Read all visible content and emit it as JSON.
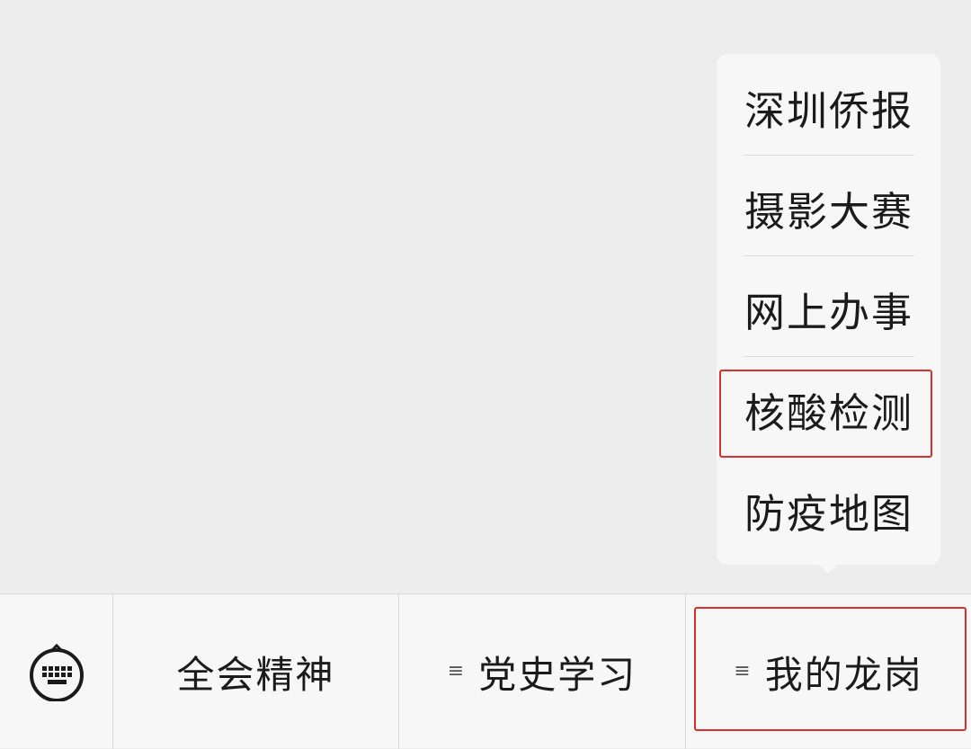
{
  "popup_menu": {
    "items": [
      {
        "label": "深圳侨报"
      },
      {
        "label": "摄影大赛"
      },
      {
        "label": "网上办事"
      },
      {
        "label": "核酸检测",
        "highlighted": true
      },
      {
        "label": "防疫地图"
      }
    ]
  },
  "bottom_menu": {
    "keyboard_icon": "keyboard-icon",
    "items": [
      {
        "label": "全会精神",
        "has_submenu": false
      },
      {
        "label": "党史学习",
        "has_submenu": true,
        "submenu_icon": "≡"
      },
      {
        "label": "我的龙岗",
        "has_submenu": true,
        "submenu_icon": "≡",
        "highlighted": true
      }
    ]
  },
  "colors": {
    "background": "#ededed",
    "panel": "#f7f7f7",
    "highlight": "#d6322b",
    "text": "#1b1b1b"
  }
}
